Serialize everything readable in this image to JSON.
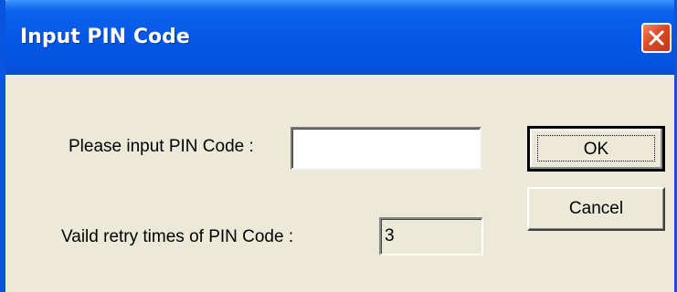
{
  "window": {
    "title": "Input PIN Code",
    "close_icon": "close-icon"
  },
  "form": {
    "pin_label": "Please input PIN Code :",
    "pin_value": "",
    "retry_label": "Vaild retry times of PIN Code :",
    "retry_value": "3"
  },
  "buttons": {
    "ok_label": "OK",
    "cancel_label": "Cancel"
  },
  "colors": {
    "title_bar": "#0758e8",
    "dialog_bg": "#ece9d8",
    "close_button": "#dc4a26"
  }
}
